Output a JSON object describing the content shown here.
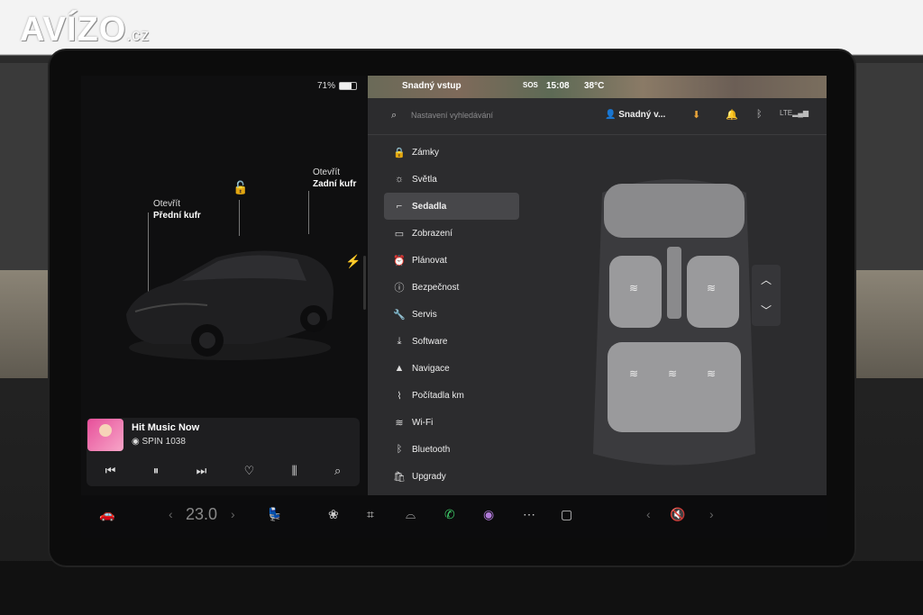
{
  "watermark": {
    "brand": "AVÍZO",
    "tld": ".cz"
  },
  "status": {
    "battery_pct": "71%",
    "battery_level": 0.71,
    "profile_top": "Snadný vstup",
    "sos": "SOS",
    "time": "15:08",
    "temp_out": "38°C"
  },
  "search": {
    "placeholder": "Nastavení vyhledávání"
  },
  "profile": {
    "name": "Snadný v..."
  },
  "car_callouts": {
    "front": {
      "label": "Otevřít",
      "value": "Přední kufr"
    },
    "rear": {
      "label": "Otevřít",
      "value": "Zadní kufr"
    }
  },
  "media": {
    "song": "Hit Music Now",
    "station": "SPIN 1038",
    "controls": [
      "prev-icon",
      "pause-icon",
      "next-icon",
      "heart-icon",
      "equalizer-icon",
      "search-icon"
    ]
  },
  "menu": {
    "items": [
      {
        "label": "Zámky",
        "icon": "lock-icon"
      },
      {
        "label": "Světla",
        "icon": "light-icon"
      },
      {
        "label": "Sedadla",
        "icon": "seat-icon",
        "active": true
      },
      {
        "label": "Zobrazení",
        "icon": "display-icon"
      },
      {
        "label": "Plánovat",
        "icon": "clock-icon"
      },
      {
        "label": "Bezpečnost",
        "icon": "info-icon"
      },
      {
        "label": "Servis",
        "icon": "wrench-icon"
      },
      {
        "label": "Software",
        "icon": "download-icon"
      },
      {
        "label": "Navigace",
        "icon": "navigation-icon"
      },
      {
        "label": "Počítadla km",
        "icon": "trip-icon"
      },
      {
        "label": "Wi-Fi",
        "icon": "wifi-icon"
      },
      {
        "label": "Bluetooth",
        "icon": "bluetooth-icon"
      },
      {
        "label": "Upgrady",
        "icon": "bag-icon"
      }
    ]
  },
  "dock": {
    "temp": "23.0"
  },
  "colors": {
    "panel": "#2c2c2e",
    "active_item": "#47474a",
    "accent_download": "#e8a33a",
    "phone_green": "#3fcf6a"
  }
}
